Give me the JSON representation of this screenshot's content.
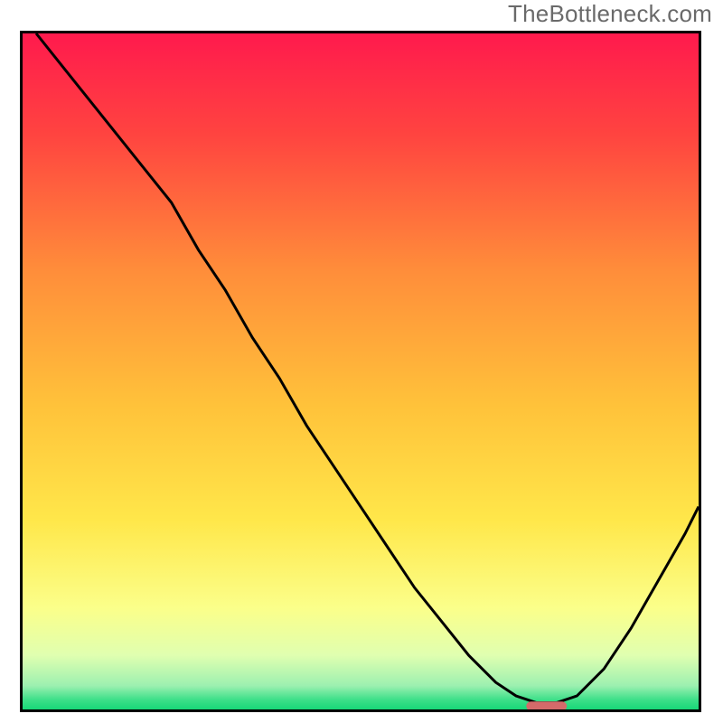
{
  "watermark_text": "TheBottleneck.com",
  "chart_data": {
    "type": "line",
    "title": "",
    "xlabel": "",
    "ylabel": "",
    "xlim": [
      0,
      100
    ],
    "ylim": [
      0,
      100
    ],
    "grid": false,
    "series": [
      {
        "name": "curve",
        "x": [
          2,
          6,
          10,
          14,
          18,
          22,
          26,
          30,
          34,
          38,
          42,
          46,
          50,
          54,
          58,
          62,
          66,
          70,
          73,
          76,
          79,
          82,
          86,
          90,
          94,
          98,
          100
        ],
        "values": [
          100,
          95,
          90,
          85,
          80,
          75,
          68,
          62,
          55,
          49,
          42,
          36,
          30,
          24,
          18,
          13,
          8,
          4,
          2,
          1,
          1,
          2,
          6,
          12,
          19,
          26,
          30
        ]
      }
    ],
    "gradient_stops": [
      {
        "offset": 0.0,
        "color": "#ff1a4d"
      },
      {
        "offset": 0.15,
        "color": "#ff4440"
      },
      {
        "offset": 0.35,
        "color": "#ff8d3a"
      },
      {
        "offset": 0.55,
        "color": "#ffc23a"
      },
      {
        "offset": 0.72,
        "color": "#ffe74a"
      },
      {
        "offset": 0.85,
        "color": "#fbff8a"
      },
      {
        "offset": 0.92,
        "color": "#e0ffb0"
      },
      {
        "offset": 0.965,
        "color": "#9cf0b0"
      },
      {
        "offset": 0.985,
        "color": "#3fe08a"
      },
      {
        "offset": 1.0,
        "color": "#17d778"
      }
    ],
    "marker": {
      "x_center": 77.5,
      "y": 0.5,
      "width": 6,
      "color": "#d46a6a"
    }
  }
}
